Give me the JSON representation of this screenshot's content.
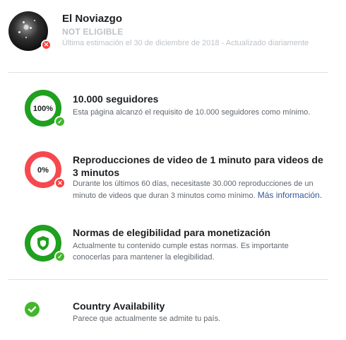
{
  "header": {
    "page_name": "El Noviazgo",
    "status": "NOT ELIGIBLE",
    "estimate": "Última estimación el 30 de diciembre de 2018 - Actualizado diariamente",
    "avatar_badge_icon": "x-icon"
  },
  "colors": {
    "ok": "#42b72a",
    "fail": "#fa3e3e",
    "muted": "#bec3c9",
    "link": "#365899"
  },
  "requirements": [
    {
      "progress_label": "100%",
      "progress": 1.0,
      "state": "met",
      "title": "10.000 seguidores",
      "description": "Esta página alcanzó el requisito de 10.000 seguidores como mínimo."
    },
    {
      "progress_label": "0%",
      "progress": 0.0,
      "state": "not-met",
      "title": "Reproducciones de video de 1 minuto para videos de 3 minutos",
      "description": "Durante los últimos 60 días, necesitaste 30.000 reproducciones de un minuto de videos que duran 3 minutos como mínimo.",
      "link": "Más información."
    },
    {
      "icon": "shield-icon",
      "state": "met",
      "title": "Normas de elegibilidad para monetización",
      "description": "Actualmente tu contenido cumple estas normas. Es importante conocerlas para mantener la elegibilidad."
    },
    {
      "icon": "check-circle-icon",
      "state": "met",
      "title": "Country Availability",
      "description": "Parece que actualmente se admite tu país."
    }
  ]
}
